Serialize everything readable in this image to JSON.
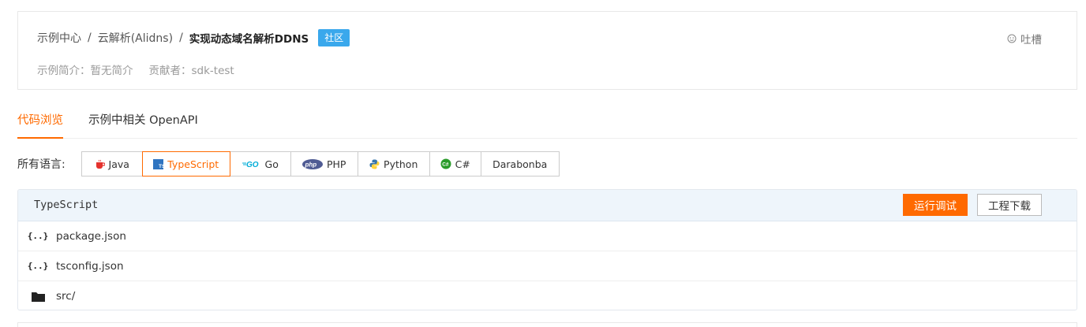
{
  "breadcrumb": {
    "items": [
      "示例中心",
      "云解析(Alidns)"
    ],
    "separator": "/",
    "current": "实现动态域名解析DDNS",
    "badge": "社区"
  },
  "feedback": {
    "label": "吐槽",
    "icon": "smiley-icon"
  },
  "meta": {
    "intro": "示例简介：暂无简介",
    "contributor": "贡献者：sdk-test"
  },
  "tabs": [
    {
      "label": "代码浏览",
      "active": true
    },
    {
      "label": "示例中相关 OpenAPI",
      "active": false
    }
  ],
  "languages": {
    "label": "所有语言:",
    "items": [
      {
        "label": "Java",
        "icon": "java-icon",
        "active": false
      },
      {
        "label": "TypeScript",
        "icon": "typescript-icon",
        "active": true
      },
      {
        "label": "Go",
        "icon": "go-icon",
        "active": false
      },
      {
        "label": "PHP",
        "icon": "php-icon",
        "active": false
      },
      {
        "label": "Python",
        "icon": "python-icon",
        "active": false
      },
      {
        "label": "C#",
        "icon": "csharp-icon",
        "active": false
      },
      {
        "label": "Darabonba",
        "icon": "",
        "active": false
      }
    ]
  },
  "files": {
    "title": "TypeScript",
    "run_label": "运行调试",
    "download_label": "工程下载",
    "items": [
      {
        "name": "package.json",
        "icon": "json-file-icon"
      },
      {
        "name": "tsconfig.json",
        "icon": "json-file-icon"
      },
      {
        "name": "src/",
        "icon": "folder-icon"
      }
    ]
  },
  "colors": {
    "accent": "#ff6a00",
    "badge": "#3aa8ec",
    "header_bg": "#eef5fb"
  }
}
